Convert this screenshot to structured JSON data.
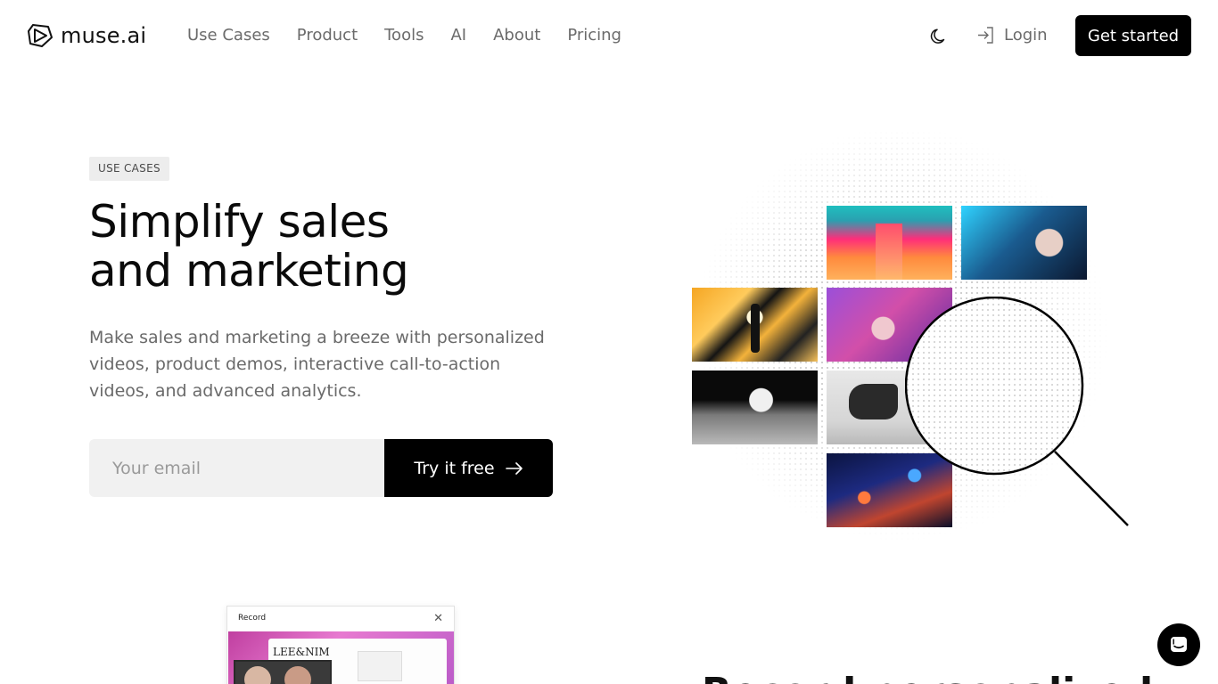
{
  "nav": {
    "brand": "muse.ai",
    "links": [
      "Use Cases",
      "Product",
      "Tools",
      "AI",
      "About",
      "Pricing"
    ],
    "theme_icon": "moon-icon",
    "login_label": "Login",
    "login_icon": "login-icon",
    "cta_label": "Get started"
  },
  "hero": {
    "badge": "USE CASES",
    "title_line1": "Simplify sales",
    "title_line2": "and marketing",
    "subtitle": "Make sales and marketing a breeze with personalized videos, product demos, interactive call-to-action videos, and advanced analytics.",
    "email_placeholder": "Your email",
    "try_label": "Try it free",
    "try_icon": "arrow-right-icon"
  },
  "collage": {
    "tiles": [
      "neon-corridor-image",
      "woman-blue-light-image",
      "gold-abstract-figure-image",
      "woman-purple-hair-image",
      "astronaut-moon-image",
      "black-chair-image",
      "city-night-aerial-image"
    ],
    "overlay_icon": "magnifier-icon"
  },
  "section2": {
    "record_window_title": "Record",
    "record_brand": "LEE&NIM",
    "heading_peek": "Record personalized"
  },
  "chat": {
    "icon": "chat-icon"
  },
  "colors": {
    "primary": "#000000",
    "nav_text": "#6b6b6b",
    "input_bg": "#f1f1f1",
    "badge_bg": "#ededed"
  }
}
